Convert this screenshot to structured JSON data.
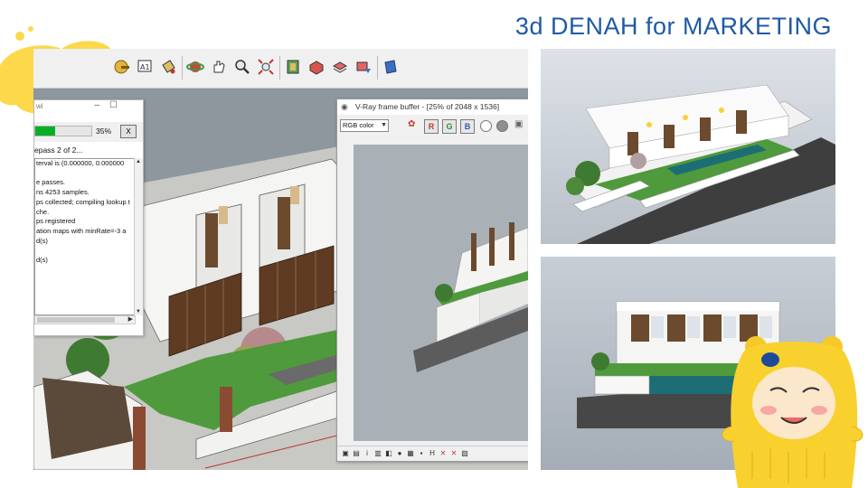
{
  "page": {
    "title": "3d DENAH for MARKETING"
  },
  "sketchup": {
    "toolbar_icons": [
      "tape-measure-icon",
      "text-label-icon",
      "paint-bucket-icon",
      "orbit-icon",
      "pan-icon",
      "zoom-icon",
      "zoom-extents-icon",
      "section-plane-icon",
      "components-icon",
      "materials-icon",
      "styles-icon",
      "layers-icon"
    ],
    "progress_window": {
      "title": "wi",
      "progress_value": 0.35,
      "progress_label": "35%",
      "close_label": "X",
      "status": "epass 2 of 2...",
      "log_lines": [
        "terval is (0.000000, 0.000000",
        "",
        "e passes.",
        "ns 4253 samples.",
        "ps collected; compiling lookup t",
        "che.",
        "ps registered",
        "ation maps with minRate=-3 a",
        "d(s)",
        "",
        "d(s)"
      ]
    },
    "vray_frame_buffer": {
      "title": "V-Ray frame buffer - [25% of 2048 x 1536]",
      "channel_select": "RGB color",
      "channel_buttons": [
        "R",
        "G",
        "B"
      ],
      "bottom_icons": [
        "save-image-icon",
        "region-render-icon",
        "info-icon",
        "histogram-icon",
        "color-correct-icon",
        "lens-effects-icon",
        "stamp-icon",
        "pixel-info-icon",
        "history-icon",
        "compare-a-icon",
        "compare-b-icon",
        "lut-icon"
      ]
    }
  },
  "colors": {
    "title": "#1f5aa5",
    "accent_yellow": "#fcd84a",
    "progress_fill": "#06b025",
    "lawn": "#4f9a3c",
    "timber": "#6b4a2e",
    "pool": "#1c6e74"
  }
}
